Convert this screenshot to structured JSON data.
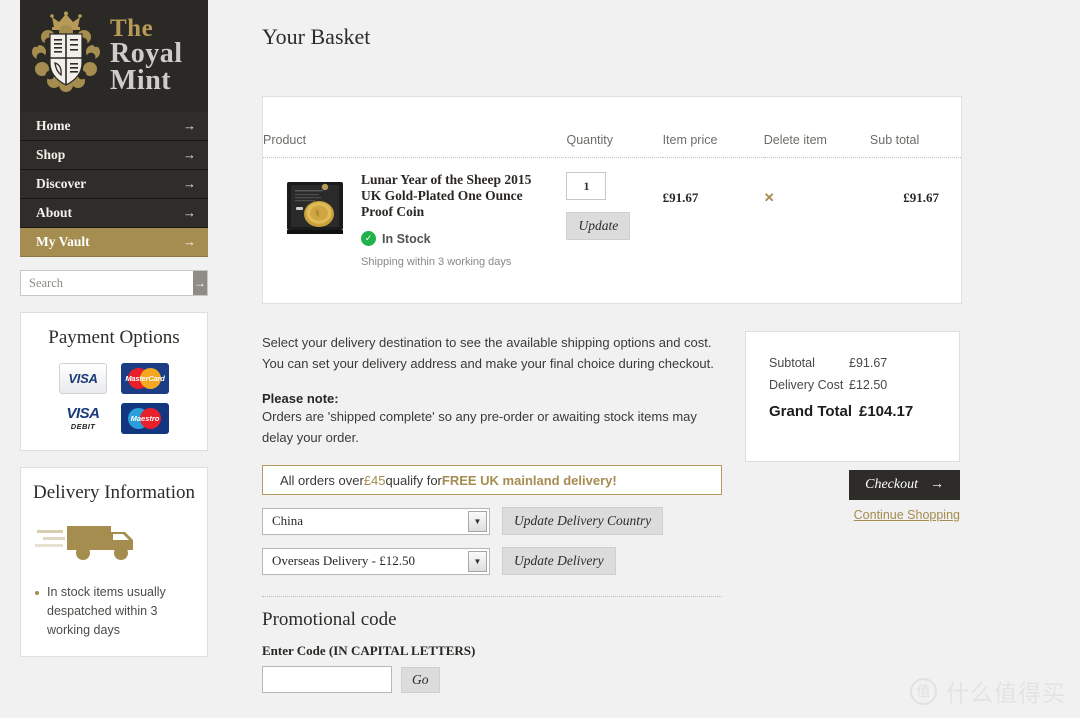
{
  "brand": {
    "line1": "The",
    "line2": "Royal",
    "line3": "Mint",
    "logo_icon": "royal-mint-crest-icon",
    "gold": "#a58c4f",
    "dark": "#2f2d2a"
  },
  "nav": {
    "items": [
      {
        "label": "Home",
        "arrow": "→",
        "active": false
      },
      {
        "label": "Shop",
        "arrow": "→",
        "active": false
      },
      {
        "label": "Discover",
        "arrow": "→",
        "active": false
      },
      {
        "label": "About",
        "arrow": "→",
        "active": false
      },
      {
        "label": "My Vault",
        "arrow": "→",
        "active": true
      }
    ]
  },
  "search": {
    "placeholder": "Search",
    "value": "",
    "button_label": "→",
    "icon": "arrow-right-icon"
  },
  "payment_panel": {
    "title": "Payment Options",
    "cards": [
      {
        "name": "visa",
        "label": "VISA"
      },
      {
        "name": "mastercard",
        "label": "MasterCard"
      },
      {
        "name": "visa-debit",
        "label": "VISA",
        "sub": "DEBIT"
      },
      {
        "name": "maestro",
        "label": "Maestro"
      }
    ]
  },
  "delivery_panel": {
    "title": "Delivery Information",
    "icon": "delivery-truck-icon",
    "bullets": [
      "In stock items usually despatched within 3 working days"
    ]
  },
  "main": {
    "title": "Your Basket"
  },
  "basket": {
    "columns": [
      "Product",
      "Quantity",
      "Item price",
      "Delete item",
      "Sub total"
    ],
    "rows": [
      {
        "thumb_icon": "coin-presentation-case-image",
        "name": "Lunar Year of the Sheep 2015 UK Gold-Plated One Ounce Proof Coin",
        "stock_status": "In Stock",
        "stock_icon": "check-circle-icon",
        "shipping_note": "Shipping within 3 working days",
        "quantity": "1",
        "update_label": "Update",
        "item_price": "£91.67",
        "delete_icon": "✕",
        "sub_total": "£91.67"
      }
    ]
  },
  "delivery_section": {
    "intro_line1": "Select your delivery destination to see the available shipping options and cost.",
    "intro_line2": "You can set your delivery address and make your final choice during checkout.",
    "note_title": "Please note:",
    "note_body": "Orders are 'shipped complete' so any pre-order or awaiting stock items may delay your order.",
    "free_banner": {
      "prefix": "All orders over ",
      "amount": "£45",
      "middle": " qualify for ",
      "highlight": "FREE UK mainland delivery!"
    },
    "country_select": {
      "value": "China",
      "button_label": "Update Delivery Country",
      "caret_icon": "chevron-down-icon"
    },
    "method_select": {
      "value": "Overseas Delivery - £12.50",
      "button_label": "Update Delivery",
      "caret_icon": "chevron-down-icon"
    }
  },
  "totals": {
    "rows": [
      {
        "label": "Subtotal",
        "value": "£91.67"
      },
      {
        "label": "Delivery Cost",
        "value": "£12.50"
      }
    ],
    "grand": {
      "label": "Grand Total",
      "value": "£104.17"
    },
    "checkout_label": "Checkout",
    "checkout_arrow": "→",
    "continue_label": "Continue Shopping"
  },
  "promo": {
    "title": "Promotional code",
    "label": "Enter Code (IN CAPITAL LETTERS)",
    "value": "",
    "placeholder": "",
    "button_label": "Go"
  },
  "watermark": {
    "logo_char": "值",
    "text": "什么值得买"
  }
}
